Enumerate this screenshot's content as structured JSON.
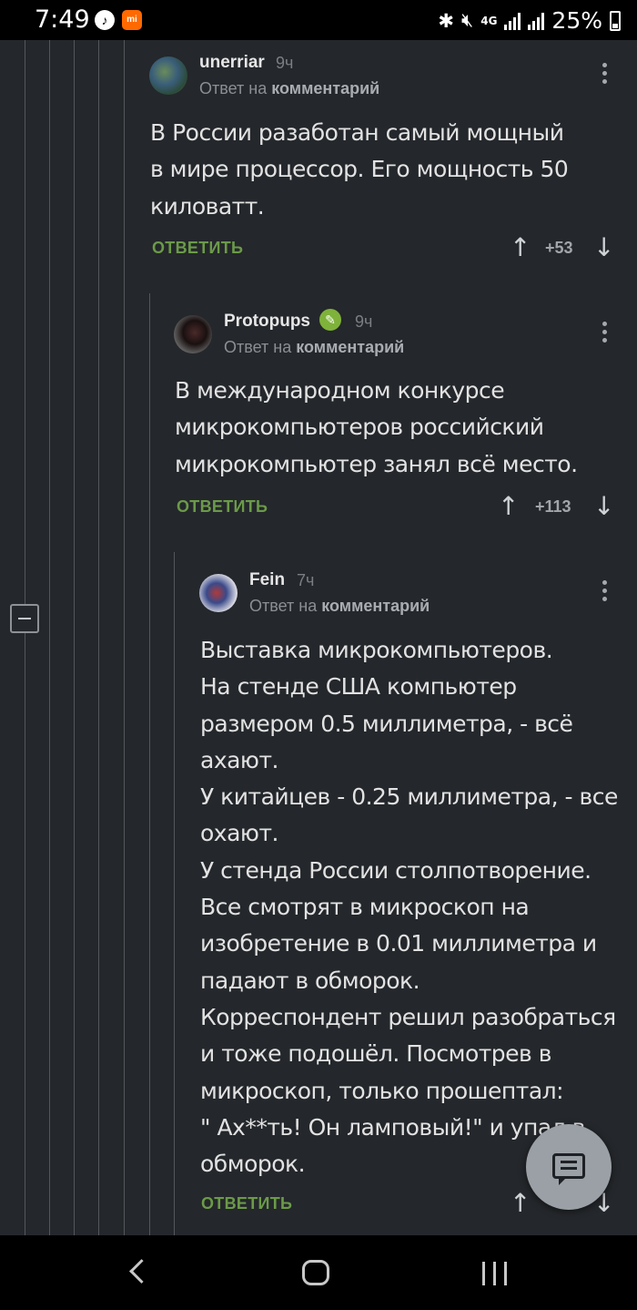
{
  "status_bar": {
    "time": "7:49",
    "network": "4G",
    "battery": "25%",
    "icons": [
      "music-icon",
      "mi-icon",
      "bluetooth-icon",
      "mute-icon",
      "signal-icon",
      "battery-icon"
    ]
  },
  "comments": [
    {
      "author": "unerriar",
      "time": "9ч",
      "reply_prefix": "Ответ на",
      "reply_link": "комментарий",
      "lines": [
        "В России разаботан самый мощный",
        "в мире процессор. Его мощность 50",
        "киловатт."
      ],
      "reply_label": "ОТВЕТИТЬ",
      "score": "+53"
    },
    {
      "author": "Protopups",
      "time": "9ч",
      "reply_prefix": "Ответ на",
      "reply_link": "комментарий",
      "lines": [
        "В международном конкурсе",
        "микрокомпьютеров российский",
        "микрокомпьютер занял всё место."
      ],
      "reply_label": "ОТВЕТИТЬ",
      "score": "+113"
    },
    {
      "author": "Fein",
      "time": "7ч",
      "reply_prefix": "Ответ на",
      "reply_link": "комментарий",
      "lines": [
        "Выставка микрокомпьютеров.",
        "На стенде США компьютер",
        "размером 0.5 миллиметра, - всё",
        "ахают.",
        "У китайцев - 0.25 миллиметра, - все",
        "охают.",
        "У стенда России столпотворение.",
        "Все смотрят в микроскоп на",
        "изобретение в 0.01 миллиметра и",
        "падают в обморок.",
        "Корреспондент решил разобраться",
        "и тоже подошёл. Посмотрев в",
        "микроскоп, только прошептал:",
        "\" Ах**ть! Он ламповый!\" и упал в",
        "обморок."
      ],
      "reply_label": "ОТВЕТИТЬ",
      "score": ""
    }
  ],
  "colors": {
    "background": "#24272b",
    "reply_green": "#6b9a49",
    "badge_green": "#7fb23a"
  }
}
